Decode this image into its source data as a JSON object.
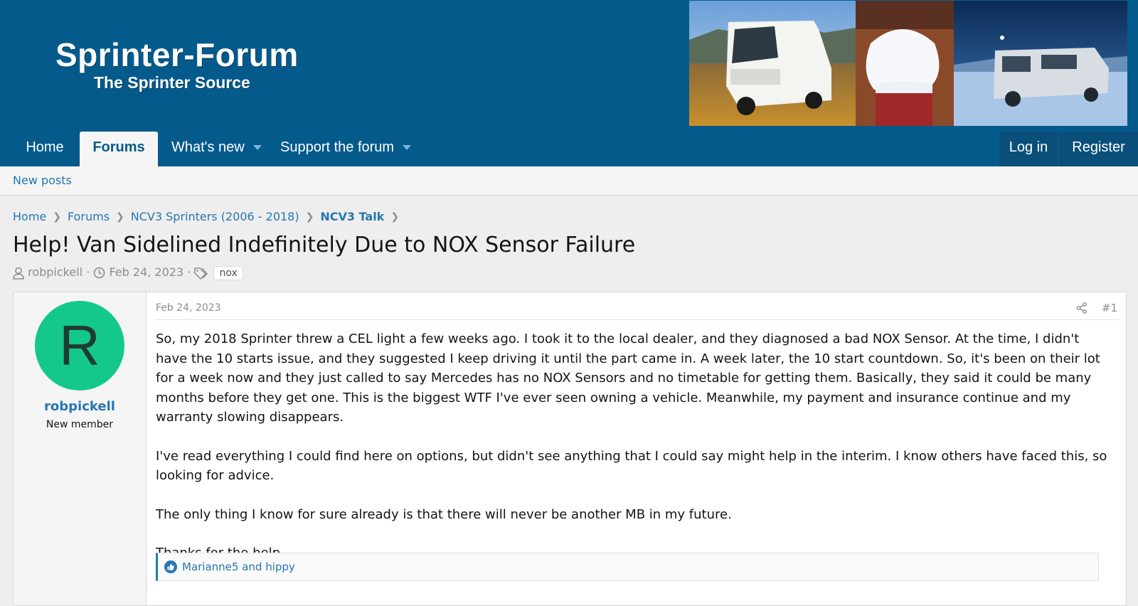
{
  "site": {
    "title": "Sprinter-Forum",
    "subtitle": "The Sprinter Source"
  },
  "nav": {
    "home": "Home",
    "forums": "Forums",
    "whats_new": "What's new",
    "support": "Support the forum",
    "login": "Log in",
    "register": "Register"
  },
  "subnav": {
    "new_posts": "New posts"
  },
  "breadcrumb": [
    "Home",
    "Forums",
    "NCV3 Sprinters (2006 - 2018)",
    "NCV3 Talk"
  ],
  "thread": {
    "title": "Help! Van Sidelined Indefinitely Due to NOX Sensor Failure",
    "author": "robpickell",
    "date": "Feb 24, 2023",
    "tag": "nox"
  },
  "post": {
    "avatar_letter": "R",
    "username": "robpickell",
    "user_title": "New member",
    "date": "Feb 24, 2023",
    "number": "#1",
    "paragraphs": [
      "So, my 2018 Sprinter threw a CEL light a few weeks ago. I took it to the local dealer, and they diagnosed a bad NOX Sensor. At the time, I didn't have the 10 starts issue, and they suggested I keep driving it until the part came in. A week later, the 10 start countdown. So, it's been on their lot for a week now and they just called to say Mercedes has no NOX Sensors and no timetable for getting them. Basically, they said it could be many months before they get one. This is the biggest WTF I've ever seen owning a vehicle. Meanwhile, my payment and insurance continue and my warranty slowing disappears.",
      "I've read everything I could find here on options, but didn't see anything that I could say might help in the interim. I know others have faced this, so looking for advice.",
      "The only thing I know for sure already is that there will never be another MB in my future.",
      "Thanks for the help."
    ],
    "reactions": "Marianne5 and hippy"
  },
  "colors": {
    "header": "#055a8c",
    "link": "#2577b1",
    "avatar": "#14c88c"
  }
}
